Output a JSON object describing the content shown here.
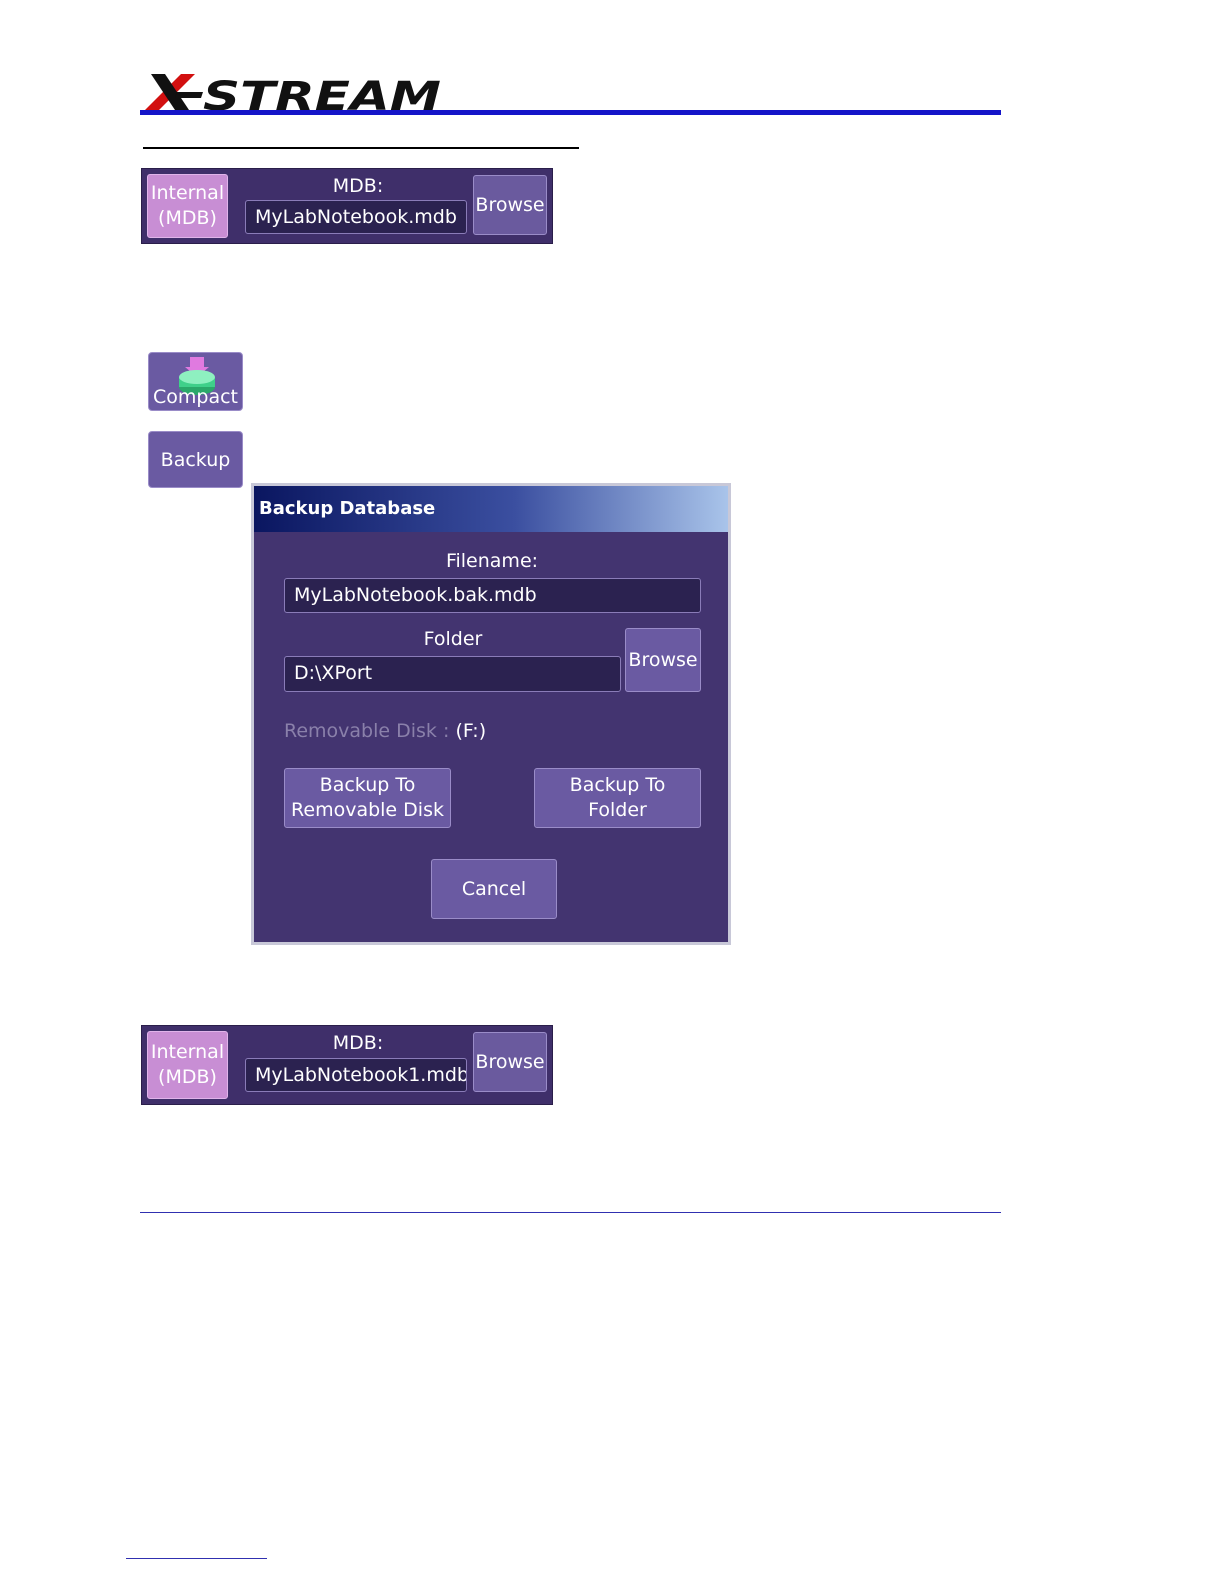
{
  "header": {
    "logo_text": "X-STREAM"
  },
  "mdb_panel_1": {
    "internal_line1": "Internal",
    "internal_line2": "(MDB)",
    "mdb_label": "MDB:",
    "mdb_value": "MyLabNotebook.mdb",
    "browse_label": "Browse"
  },
  "buttons": {
    "compact_label": "Compact",
    "backup_label": "Backup"
  },
  "backup_dialog": {
    "title": "Backup Database",
    "filename_label": "Filename:",
    "filename_value": "MyLabNotebook.bak.mdb",
    "folder_label": "Folder",
    "folder_value": "D:\\XPort",
    "browse_label": "Browse",
    "removable_label": "Removable Disk :",
    "removable_value": "(F:)",
    "backup_removable_line1": "Backup To",
    "backup_removable_line2": "Removable Disk",
    "backup_folder_line1": "Backup To",
    "backup_folder_line2": "Folder",
    "cancel_label": "Cancel"
  },
  "mdb_panel_2": {
    "internal_line1": "Internal",
    "internal_line2": "(MDB)",
    "mdb_label": "MDB:",
    "mdb_value": "MyLabNotebook1.mdb",
    "browse_label": "Browse"
  },
  "colors": {
    "header_rule": "#1414c8",
    "panel_bg": "#3f2f6a",
    "internal_button": "#c88ed4",
    "dialog_bg": "#433470",
    "logo_red": "#d21010"
  }
}
